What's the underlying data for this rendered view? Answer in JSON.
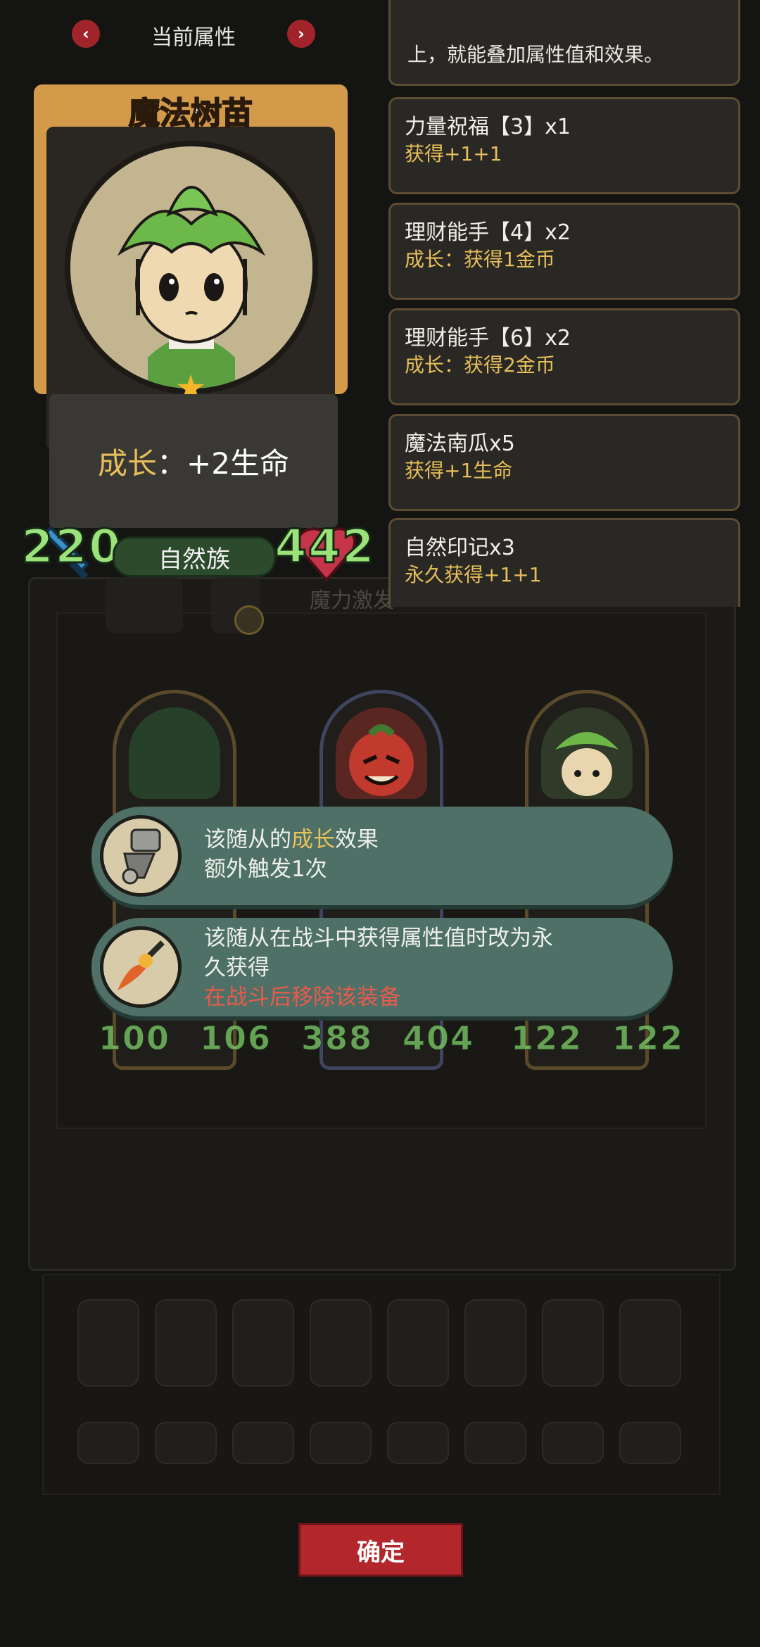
{
  "header": {
    "title": "当前属性",
    "prev_icon": "chevron-left-icon",
    "next_icon": "chevron-right-icon",
    "prev_glyph": "‹",
    "next_glyph": "›"
  },
  "hero": {
    "name": "魔法树苗",
    "growth_label": "成长",
    "growth_sep": "：",
    "growth_value": "+2生命",
    "tribe": "自然族",
    "attack": "220",
    "health": "442",
    "star_glyph": "★"
  },
  "buffs": {
    "truncated_top": "上，就能叠加属性值和效果。",
    "items": [
      {
        "title": "力量祝福【3】x1",
        "desc": "获得+1+1"
      },
      {
        "title": "理财能手【4】x2",
        "desc": "成长：获得1金币"
      },
      {
        "title": "理财能手【6】x2",
        "desc": "成长：获得2金币"
      },
      {
        "title": "魔法南瓜x5",
        "desc": "获得+1生命"
      },
      {
        "title": "自然印记x3",
        "desc": "永久获得+1+1"
      }
    ]
  },
  "background": {
    "ghost_text": "魔力激发"
  },
  "minions": [
    {
      "attack": "100",
      "health": "106"
    },
    {
      "attack": "388",
      "health": "404"
    },
    {
      "attack": "122",
      "health": "122"
    }
  ],
  "tooltips": [
    {
      "line1_pre": "该随从的",
      "line1_hl": "成长",
      "line1_post": "效果",
      "line2": "额外触发1次"
    },
    {
      "line1": "该随从在战斗中获得属性值时改为永",
      "line2": "久获得",
      "line3": "在战斗后移除该装备"
    }
  ],
  "confirm_label": "确定",
  "colors": {
    "accent_red": "#b3262b",
    "stat_green": "#9be27b",
    "highlight_gold": "#e8c25b",
    "warning_red": "#ea5b4c",
    "tooltip_bg": "#4e7066"
  }
}
